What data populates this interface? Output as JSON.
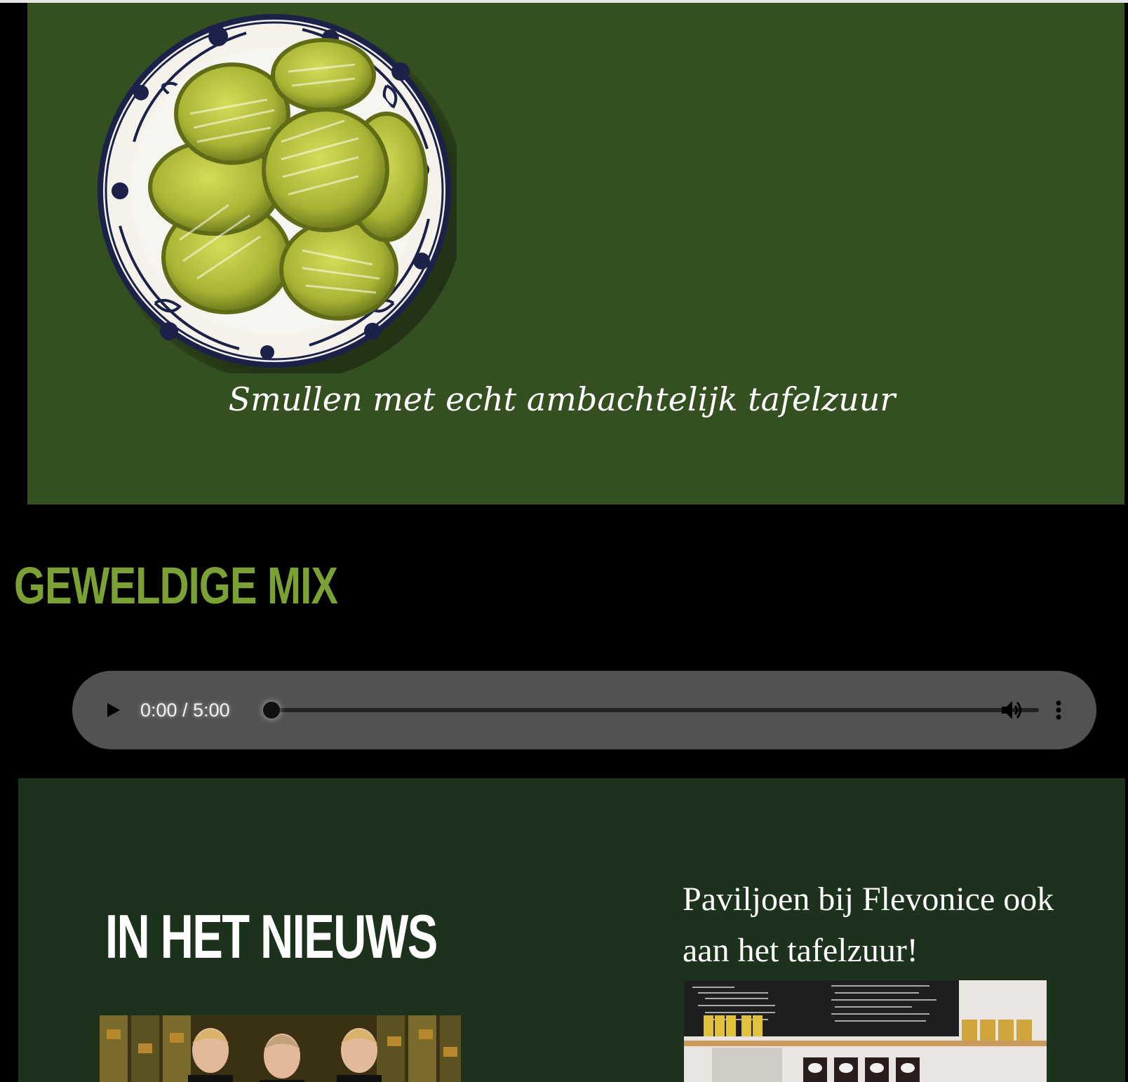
{
  "hero": {
    "tagline": "Smullen met echt ambachtelijk tafelzuur",
    "bg_color": "#344f20"
  },
  "mix": {
    "title": "GEWELDIGE MIX",
    "title_color": "#7ba135"
  },
  "audio": {
    "time": "0:00 / 5:00",
    "progress": 0
  },
  "news": {
    "title": "IN HET NIEUWS",
    "article_title": "Paviljoen bij Flevonice ook aan het tafelzuur!",
    "bg_color": "#1c321d"
  }
}
